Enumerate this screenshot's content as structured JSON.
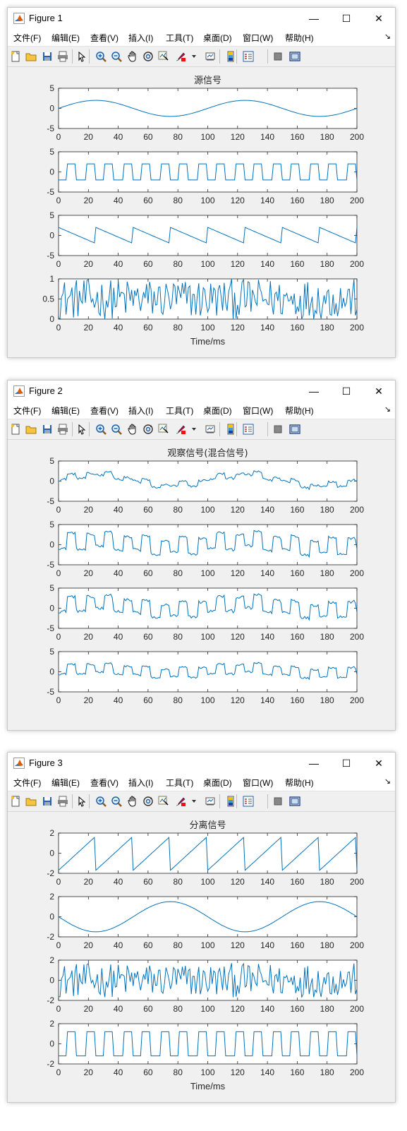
{
  "menu": [
    "文件(F)",
    "编辑(E)",
    "查看(V)",
    "插入(I)",
    "工具(T)",
    "桌面(D)",
    "窗口(W)",
    "帮助(H)"
  ],
  "toolbar_icons": [
    "new-figure-icon",
    "open-file-icon",
    "save-icon",
    "print-icon",
    "edit-plot-arrow-icon",
    "zoom-in-icon",
    "zoom-out-icon",
    "pan-hand-icon",
    "rotate-3d-icon",
    "data-cursor-icon",
    "brush-icon",
    "brush-dropdown-icon",
    "link-plot-icon",
    "insert-colorbar-icon",
    "insert-legend-icon",
    "hide-plot-tools-icon",
    "show-plot-tools-icon"
  ],
  "window_controls": {
    "minimize": "—",
    "maximize": "☐",
    "close": "✕"
  },
  "colors": {
    "line": "#0072bd",
    "figure_bg": "#f0f0f0",
    "axes_bg": "#ffffff"
  },
  "figures": [
    {
      "title": "Figure 1"
    },
    {
      "title": "Figure 2"
    },
    {
      "title": "Figure 3"
    }
  ],
  "chart_data": [
    {
      "type": "line",
      "figure": "Figure 1",
      "title": "源信号",
      "xlabel": "Time/ms",
      "subplots": [
        {
          "signal": "sine",
          "amplitude": 2,
          "period": 100,
          "xlim": [
            0,
            200
          ],
          "ylim": [
            -5,
            5
          ],
          "yticks": [
            "5",
            "0",
            "-5"
          ]
        },
        {
          "signal": "square",
          "amplitude": 2,
          "period": 12.5,
          "xlim": [
            0,
            200
          ],
          "ylim": [
            -5,
            5
          ],
          "yticks": [
            "5",
            "0",
            "-5"
          ]
        },
        {
          "signal": "sawtooth",
          "range": [
            -2,
            2
          ],
          "period": 25,
          "direction": "falling",
          "xlim": [
            0,
            200
          ],
          "ylim": [
            -5,
            5
          ],
          "yticks": [
            "5",
            "0",
            "-5"
          ]
        },
        {
          "signal": "uniform-noise",
          "range": [
            0,
            1
          ],
          "xlim": [
            0,
            200
          ],
          "ylim": [
            0,
            1
          ],
          "yticks": [
            "1",
            "0.5",
            "0"
          ]
        }
      ],
      "xticks": [
        "0",
        "20",
        "40",
        "60",
        "80",
        "100",
        "120",
        "140",
        "160",
        "180",
        "200"
      ]
    },
    {
      "type": "line",
      "figure": "Figure 2",
      "title": "观察信号(混合信号)",
      "xlabel": "",
      "subplots": [
        {
          "signal": "mixture",
          "weights": [
            0.7,
            0.3,
            0.3,
            0.6
          ],
          "xlim": [
            0,
            200
          ],
          "ylim": [
            -5,
            5
          ],
          "yticks": [
            "5",
            "0",
            "-5"
          ]
        },
        {
          "signal": "mixture",
          "weights": [
            0.4,
            1.0,
            0.4,
            0.6
          ],
          "xlim": [
            0,
            200
          ],
          "ylim": [
            -5,
            5
          ],
          "yticks": [
            "5",
            "0",
            "-5"
          ]
        },
        {
          "signal": "mixture",
          "weights": [
            0.5,
            0.9,
            0.3,
            0.8
          ],
          "xlim": [
            0,
            200
          ],
          "ylim": [
            -5,
            5
          ],
          "yticks": [
            "5",
            "0",
            "-5"
          ]
        },
        {
          "signal": "mixture",
          "weights": [
            0.3,
            0.6,
            0.2,
            0.5
          ],
          "xlim": [
            0,
            200
          ],
          "ylim": [
            -5,
            5
          ],
          "yticks": [
            "5",
            "0",
            "-5"
          ]
        }
      ],
      "xticks": [
        "0",
        "20",
        "40",
        "60",
        "80",
        "100",
        "120",
        "140",
        "160",
        "180",
        "200"
      ]
    },
    {
      "type": "line",
      "figure": "Figure 3",
      "title": "分离信号",
      "xlabel": "Time/ms",
      "subplots": [
        {
          "signal": "sawtooth",
          "range": [
            -1.7,
            1.7
          ],
          "period": 25,
          "direction": "rising",
          "xlim": [
            0,
            200
          ],
          "ylim": [
            -2,
            2
          ],
          "yticks": [
            "2",
            "0",
            "-2"
          ]
        },
        {
          "signal": "sine",
          "amplitude": -1.5,
          "period": 100,
          "xlim": [
            0,
            200
          ],
          "ylim": [
            -2,
            2
          ],
          "yticks": [
            "2",
            "0",
            "-2"
          ]
        },
        {
          "signal": "uniform-noise",
          "range": [
            -1.7,
            1.7
          ],
          "xlim": [
            0,
            200
          ],
          "ylim": [
            -2,
            2
          ],
          "yticks": [
            "2",
            "0",
            "-2"
          ]
        },
        {
          "signal": "square",
          "amplitude": 1.2,
          "period": 12.5,
          "xlim": [
            0,
            200
          ],
          "ylim": [
            -2,
            2
          ],
          "yticks": [
            "2",
            "0",
            "-2"
          ]
        }
      ],
      "xticks": [
        "0",
        "20",
        "40",
        "60",
        "80",
        "100",
        "120",
        "140",
        "160",
        "180",
        "200"
      ]
    }
  ]
}
